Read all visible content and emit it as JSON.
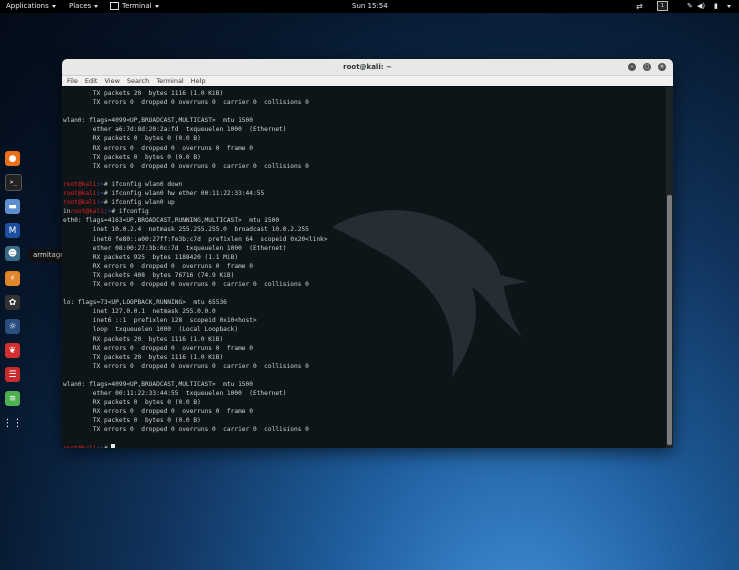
{
  "topbar": {
    "applications": "Applications",
    "places": "Places",
    "terminal": "Terminal",
    "clock": "Sun 15:54",
    "workspace": "1"
  },
  "dock": {
    "tooltip": "armitage",
    "items": [
      "firefox-icon",
      "terminal-icon",
      "files-icon",
      "metasploit-icon",
      "armitage-icon",
      "burpsuite-icon",
      "beef-icon",
      "faraday-icon",
      "cherrytree-icon",
      "maltego-icon",
      "notes-icon",
      "apps-grid-icon"
    ]
  },
  "window": {
    "title": "root@kali: ~",
    "menu": [
      "File",
      "Edit",
      "View",
      "Search",
      "Terminal",
      "Help"
    ]
  },
  "terminal": {
    "lines": [
      {
        "t": "        TX packets 20  bytes 1116 (1.0 KiB)"
      },
      {
        "t": "        TX errors 0  dropped 0 overruns 0  carrier 0  collisions 0"
      },
      {
        "t": ""
      },
      {
        "t": "wlan0: flags=4099<UP,BROADCAST,MULTICAST>  mtu 1500"
      },
      {
        "t": "        ether a6:7d:8d:20:2a:fd  txqueuelen 1000  (Ethernet)"
      },
      {
        "t": "        RX packets 0  bytes 0 (0.0 B)"
      },
      {
        "t": "        RX errors 0  dropped 0  overruns 0  frame 0"
      },
      {
        "t": "        TX packets 0  bytes 0 (0.0 B)"
      },
      {
        "t": "        TX errors 0  dropped 0 overruns 0  carrier 0  collisions 0"
      },
      {
        "t": ""
      },
      {
        "p": "root@kali",
        "s": ":~",
        "c": "# ifconfig wlan0 down"
      },
      {
        "p": "root@kali",
        "s": ":~",
        "c": "# ifconfig wlan0 hw ether 00:11:22:33:44:55"
      },
      {
        "p": "root@kali",
        "s": ":~",
        "c": "# ifconfig wlan0 up"
      },
      {
        "pre": "in",
        "p": "root@kali",
        "s": ":~",
        "c": "# ifconfig"
      },
      {
        "t": "eth0: flags=4163<UP,BROADCAST,RUNNING,MULTICAST>  mtu 1500"
      },
      {
        "t": "        inet 10.0.2.4  netmask 255.255.255.0  broadcast 10.0.2.255"
      },
      {
        "t": "        inet6 fe80::a00:27ff:fe3b:c7d  prefixlen 64  scopeid 0x20<link>"
      },
      {
        "t": "        ether 08:00:27:3b:0c:7d  txqueuelen 1000  (Ethernet)"
      },
      {
        "t": "        RX packets 925  bytes 1188420 (1.1 MiB)"
      },
      {
        "t": "        RX errors 0  dropped 0  overruns 0  frame 0"
      },
      {
        "t": "        TX packets 408  bytes 76716 (74.9 KiB)"
      },
      {
        "t": "        TX errors 0  dropped 0 overruns 0  carrier 0  collisions 0"
      },
      {
        "t": ""
      },
      {
        "t": "lo: flags=73<UP,LOOPBACK,RUNNING>  mtu 65536"
      },
      {
        "t": "        inet 127.0.0.1  netmask 255.0.0.0"
      },
      {
        "t": "        inet6 ::1  prefixlen 128  scopeid 0x10<host>"
      },
      {
        "t": "        loop  txqueuelen 1000  (Local Loopback)"
      },
      {
        "t": "        RX packets 20  bytes 1116 (1.0 KiB)"
      },
      {
        "t": "        RX errors 0  dropped 0  overruns 0  frame 0"
      },
      {
        "t": "        TX packets 20  bytes 1116 (1.0 KiB)"
      },
      {
        "t": "        TX errors 0  dropped 0 overruns 0  carrier 0  collisions 0"
      },
      {
        "t": ""
      },
      {
        "t": "wlan0: flags=4099<UP,BROADCAST,MULTICAST>  mtu 1500"
      },
      {
        "t": "        ether 00:11:22:33:44:55  txqueuelen 1000  (Ethernet)"
      },
      {
        "t": "        RX packets 0  bytes 0 (0.0 B)"
      },
      {
        "t": "        RX errors 0  dropped 0  overruns 0  frame 0"
      },
      {
        "t": "        TX packets 0  bytes 0 (0.0 B)"
      },
      {
        "t": "        TX errors 0  dropped 0 overruns 0  carrier 0  collisions 0"
      },
      {
        "t": ""
      },
      {
        "p": "root@kali",
        "s": ":~",
        "c": "# ",
        "cursor": true
      }
    ]
  }
}
